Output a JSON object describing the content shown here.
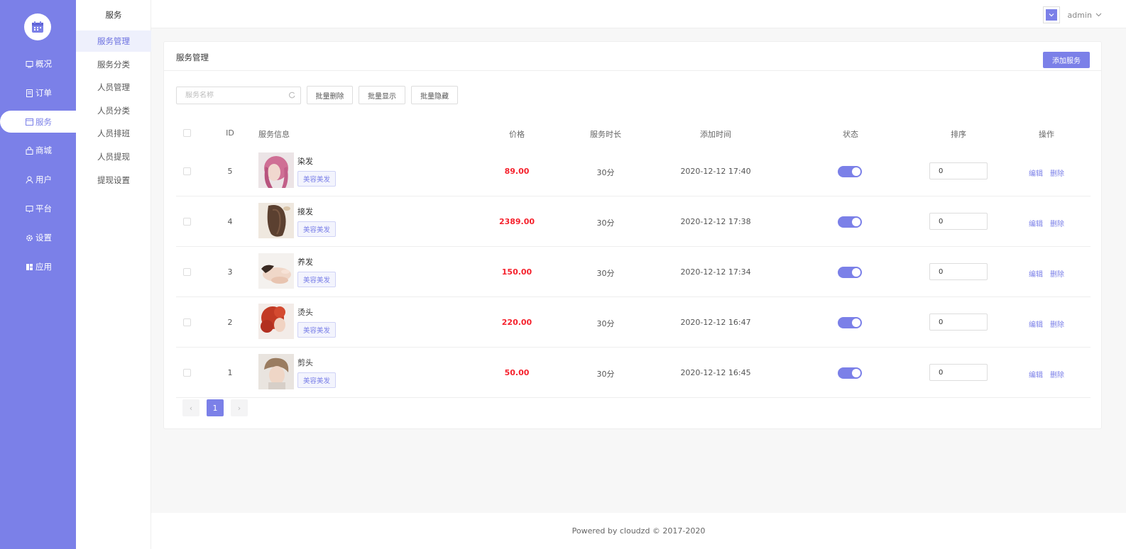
{
  "sidebar": {
    "logo_icon": "calendar-icon",
    "items": [
      {
        "label": "概况",
        "icon": "overview-icon"
      },
      {
        "label": "订单",
        "icon": "order-icon"
      },
      {
        "label": "服务",
        "icon": "calendar-icon",
        "active": true
      },
      {
        "label": "商城",
        "icon": "shop-icon"
      },
      {
        "label": "用户",
        "icon": "user-icon"
      },
      {
        "label": "平台",
        "icon": "platform-icon"
      },
      {
        "label": "设置",
        "icon": "gear-icon"
      },
      {
        "label": "应用",
        "icon": "apps-icon"
      }
    ]
  },
  "subnav": {
    "title": "服务",
    "items": [
      {
        "label": "服务管理",
        "active": true
      },
      {
        "label": "服务分类"
      },
      {
        "label": "人员管理"
      },
      {
        "label": "人员分类"
      },
      {
        "label": "人员排班"
      },
      {
        "label": "人员提现"
      },
      {
        "label": "提现设置"
      }
    ]
  },
  "header": {
    "user_name": "admin"
  },
  "card": {
    "title": "服务管理",
    "add_button": "添加服务",
    "search_placeholder": "服务名称",
    "tool_buttons": [
      "批量删除",
      "批量显示",
      "批量隐藏"
    ]
  },
  "table": {
    "columns": {
      "id": "ID",
      "info": "服务信息",
      "price": "价格",
      "duration": "服务时长",
      "added": "添加时间",
      "status": "状态",
      "sort": "排序",
      "ops": "操作"
    },
    "rows": [
      {
        "id": "5",
        "name": "染发",
        "tag": "美容美发",
        "price": "89.00",
        "duration": "30分",
        "added": "2020-12-12 17:40",
        "status_on": true,
        "sort": "0"
      },
      {
        "id": "4",
        "name": "接发",
        "tag": "美容美发",
        "price": "2389.00",
        "duration": "30分",
        "added": "2020-12-12 17:38",
        "status_on": true,
        "sort": "0"
      },
      {
        "id": "3",
        "name": "养发",
        "tag": "美容美发",
        "price": "150.00",
        "duration": "30分",
        "added": "2020-12-12 17:34",
        "status_on": true,
        "sort": "0"
      },
      {
        "id": "2",
        "name": "烫头",
        "tag": "美容美发",
        "price": "220.00",
        "duration": "30分",
        "added": "2020-12-12 16:47",
        "status_on": true,
        "sort": "0"
      },
      {
        "id": "1",
        "name": "剪头",
        "tag": "美容美发",
        "price": "50.00",
        "duration": "30分",
        "added": "2020-12-12 16:45",
        "status_on": true,
        "sort": "0"
      }
    ],
    "op_edit": "编辑",
    "op_delete": "删除"
  },
  "pagination": {
    "prev": "‹",
    "current": "1",
    "next": "›"
  },
  "footer": {
    "text": "Powered by cloudzd © 2017-2020"
  },
  "colors": {
    "accent": "#7b80e8",
    "price": "#f5222d"
  }
}
